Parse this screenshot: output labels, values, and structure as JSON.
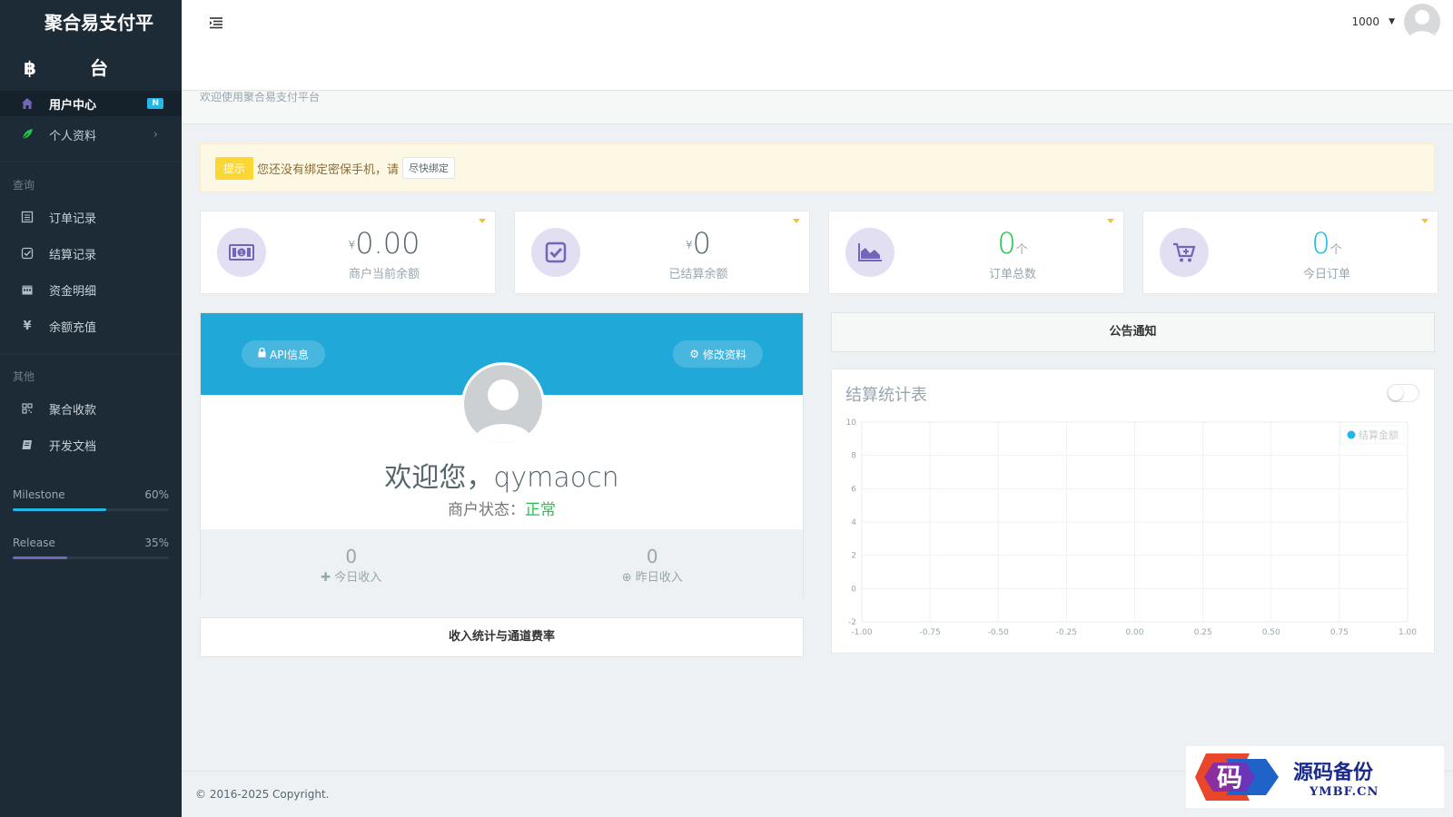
{
  "sidebar": {
    "brand": "聚合易支付平台",
    "items": [
      {
        "label": "用户中心",
        "badge": "N"
      },
      {
        "label": "个人资料"
      }
    ],
    "section_query": "查询",
    "query_items": [
      {
        "label": "订单记录"
      },
      {
        "label": "结算记录"
      },
      {
        "label": "资金明细"
      },
      {
        "label": "余额充值"
      }
    ],
    "section_other": "其他",
    "other_items": [
      {
        "label": "聚合收款"
      },
      {
        "label": "开发文档"
      }
    ],
    "progress": [
      {
        "label": "Milestone",
        "percent": 60,
        "display": "60%",
        "color": "#23b7e5"
      },
      {
        "label": "Release",
        "percent": 35,
        "display": "35%",
        "color": "#7266ba"
      }
    ]
  },
  "header": {
    "user": "1000"
  },
  "breadcrumb": "欢迎使用聚合易支付平台",
  "alert": {
    "tip": "提示",
    "text": "您还没有绑定密保手机，请",
    "button": "尽快绑定"
  },
  "stats": [
    {
      "currency": "¥",
      "value": "0.00",
      "unit": "",
      "label": "商户当前余额",
      "icon": "money-icon"
    },
    {
      "currency": "¥",
      "value": "0",
      "unit": "",
      "label": "已结算余额",
      "icon": "check-square-icon"
    },
    {
      "currency": "",
      "value": "0",
      "unit": "个",
      "label": "订单总数",
      "icon": "area-chart-icon"
    },
    {
      "currency": "",
      "value": "0",
      "unit": "个",
      "label": "今日订单",
      "icon": "cart-plus-icon"
    }
  ],
  "profile": {
    "api_button": "API信息",
    "edit_button": "修改资料",
    "welcome": "欢迎您，qymaocn",
    "status_label": "商户状态：",
    "status_value": "正常",
    "today_value": "0",
    "today_label": "今日收入",
    "yesterday_value": "0",
    "yesterday_label": "昨日收入"
  },
  "income_button": "收入统计与通道费率",
  "notice_title": "公告通知",
  "chart_data": {
    "type": "line",
    "title": "结算统计表",
    "series": [
      {
        "name": "结算金额",
        "values": []
      }
    ],
    "xlim": [
      -1.0,
      1.0
    ],
    "ylim": [
      -2,
      10
    ],
    "x_ticks": [
      "-1.00",
      "-0.75",
      "-0.50",
      "-0.25",
      "0.00",
      "0.25",
      "0.50",
      "0.75",
      "1.00"
    ],
    "y_ticks": [
      "10",
      "8",
      "6",
      "4",
      "2",
      "0",
      "-2"
    ],
    "grid": true,
    "legend": "top-right",
    "color": "#23b7e5"
  },
  "footer": "© 2016-2025 Copyright.",
  "watermark": {
    "logo_char": "码",
    "title": "源码备份",
    "subtitle": "YMBF.CN"
  }
}
